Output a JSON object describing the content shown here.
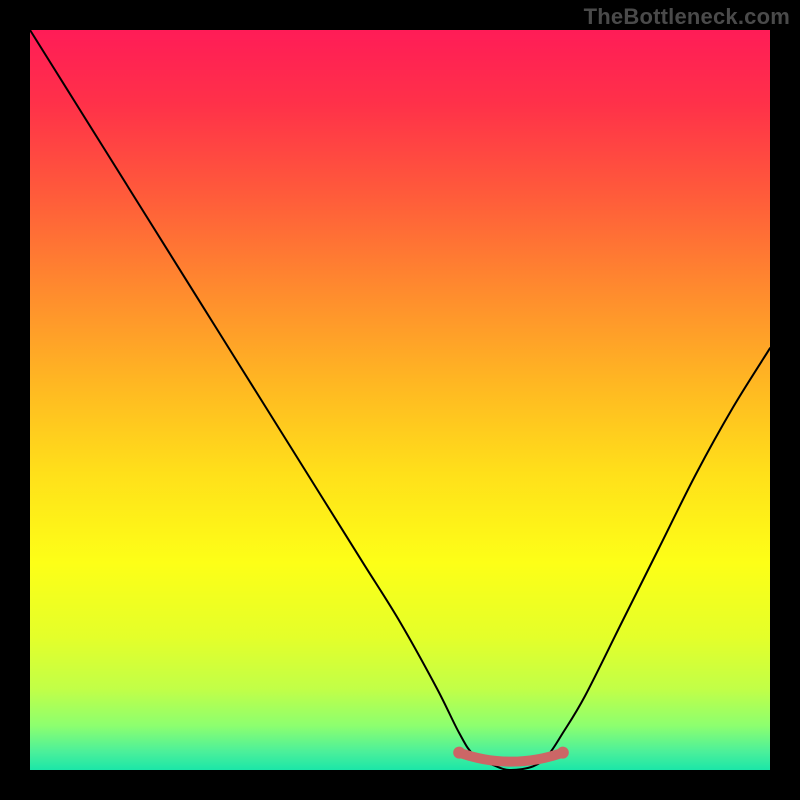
{
  "watermark": "TheBottleneck.com",
  "chart_data": {
    "type": "line",
    "title": "",
    "xlabel": "",
    "ylabel": "",
    "xlim": [
      0,
      100
    ],
    "ylim": [
      0,
      100
    ],
    "x": [
      0,
      5,
      10,
      15,
      20,
      25,
      30,
      35,
      40,
      45,
      50,
      55,
      58,
      60,
      63,
      65,
      68,
      70,
      72,
      75,
      80,
      85,
      90,
      95,
      100
    ],
    "values": [
      100,
      92,
      84,
      76,
      68,
      60,
      52,
      44,
      36,
      28,
      20,
      11,
      5,
      2,
      0.5,
      0,
      0.5,
      2,
      5,
      10,
      20,
      30,
      40,
      49,
      57
    ],
    "optimal_zone": {
      "x_start": 58,
      "x_end": 72,
      "y": 1.8
    },
    "gradient_stops": [
      {
        "pct": 0,
        "color": "#ff1c57"
      },
      {
        "pct": 10,
        "color": "#ff3149"
      },
      {
        "pct": 22,
        "color": "#ff5a3b"
      },
      {
        "pct": 35,
        "color": "#ff8a2e"
      },
      {
        "pct": 48,
        "color": "#ffb822"
      },
      {
        "pct": 60,
        "color": "#ffe01a"
      },
      {
        "pct": 72,
        "color": "#fdff17"
      },
      {
        "pct": 82,
        "color": "#e4ff2a"
      },
      {
        "pct": 89,
        "color": "#c2ff47"
      },
      {
        "pct": 94,
        "color": "#8dff6f"
      },
      {
        "pct": 97.5,
        "color": "#4cf09a"
      },
      {
        "pct": 100,
        "color": "#1be6a8"
      }
    ]
  }
}
